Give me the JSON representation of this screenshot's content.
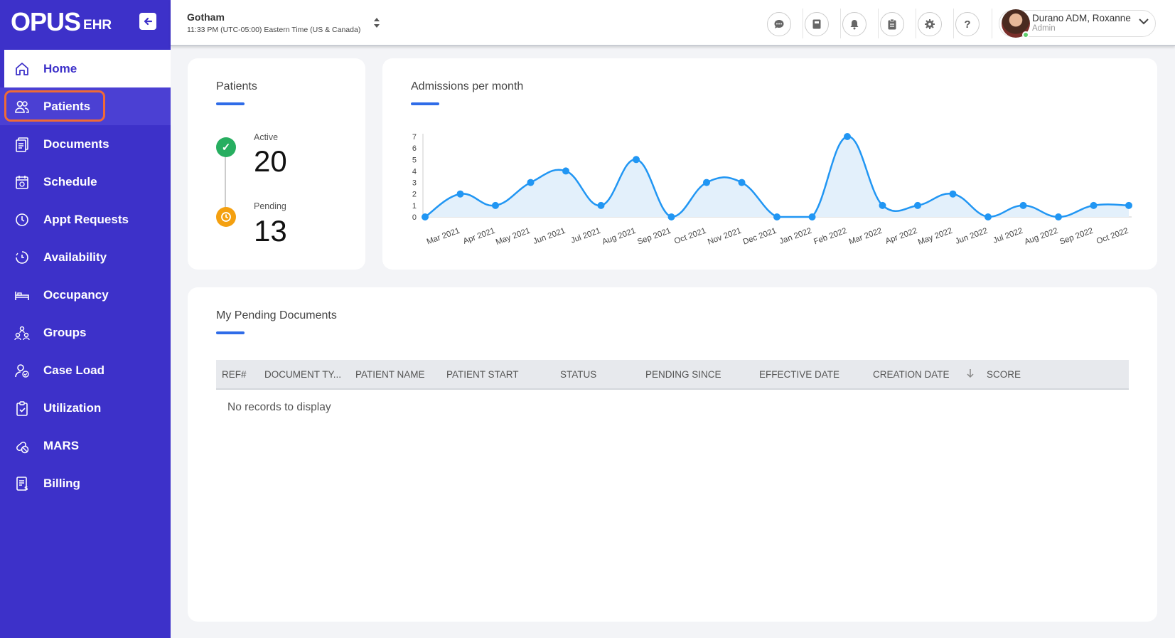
{
  "brand": {
    "logo": "OPUS",
    "sub": "EHR"
  },
  "sidebar": {
    "items": [
      {
        "label": "Home",
        "icon": "home-icon"
      },
      {
        "label": "Patients",
        "icon": "patients-icon"
      },
      {
        "label": "Documents",
        "icon": "documents-icon"
      },
      {
        "label": "Schedule",
        "icon": "calendar-icon"
      },
      {
        "label": "Appt Requests",
        "icon": "clock-icon"
      },
      {
        "label": "Availability",
        "icon": "availability-icon"
      },
      {
        "label": "Occupancy",
        "icon": "bed-icon"
      },
      {
        "label": "Groups",
        "icon": "groups-icon"
      },
      {
        "label": "Case Load",
        "icon": "case-load-icon"
      },
      {
        "label": "Utilization",
        "icon": "clipboard-check-icon"
      },
      {
        "label": "MARS",
        "icon": "pills-icon"
      },
      {
        "label": "Billing",
        "icon": "billing-icon"
      }
    ]
  },
  "header": {
    "location": "Gotham",
    "time": "11:33 PM (UTC-05:00) Eastern Time (US & Canada)",
    "user_name": "Durano ADM, Roxanne",
    "user_role": "Admin"
  },
  "patients_card": {
    "title": "Patients",
    "active_label": "Active",
    "active_value": "20",
    "pending_label": "Pending",
    "pending_value": "13"
  },
  "chart_card": {
    "title": "Admissions per month"
  },
  "chart_data": {
    "type": "area",
    "title": "Admissions per month",
    "xlabel": "",
    "ylabel": "",
    "categories": [
      "Mar 2021",
      "Apr 2021",
      "May 2021",
      "Jun 2021",
      "Jul 2021",
      "Aug 2021",
      "Sep 2021",
      "Oct 2021",
      "Nov 2021",
      "Dec 2021",
      "Jan 2022",
      "Feb 2022",
      "Mar 2022",
      "Apr 2022",
      "May 2022",
      "Jun 2022",
      "Jul 2022",
      "Aug 2022",
      "Sep 2022",
      "Oct 2022"
    ],
    "x_points": [
      "",
      "Mar 2021",
      "",
      "Apr 2021",
      "",
      "May 2021",
      "",
      "Jun 2021",
      "",
      "Jul 2021",
      "",
      "Aug 2021",
      "",
      "Sep 2021",
      "",
      "Oct 2021",
      "",
      "Nov 2021",
      "",
      "Dec 2021",
      "",
      "Jan 2022",
      "",
      "Feb 2022",
      "",
      "Mar 2022",
      "",
      "Apr 2022",
      "",
      "May 2022",
      "",
      "Jun 2022",
      "",
      "Jul 2022",
      "",
      "Aug 2022",
      "",
      "Sep 2022",
      "",
      "Oct 2022"
    ],
    "values": [
      0,
      2,
      1,
      3,
      4,
      1,
      5,
      0,
      3,
      3,
      0,
      0,
      7,
      1,
      1,
      2,
      0,
      1,
      0,
      1,
      1
    ],
    "yticks": [
      0,
      1,
      2,
      3,
      4,
      5,
      6,
      7
    ],
    "ylim": [
      0,
      7
    ],
    "color": "#2196f3",
    "fill": "#e3f0fb",
    "grid": false,
    "legend": "none"
  },
  "docs_card": {
    "title": "My Pending Documents",
    "columns": [
      "REF#",
      "DOCUMENT TY...",
      "PATIENT NAME",
      "PATIENT START",
      "STATUS",
      "PENDING SINCE",
      "EFFECTIVE DATE",
      "CREATION DATE",
      "SCORE"
    ],
    "empty_text": "No records to display"
  },
  "colors": {
    "sidebar": "#3d31c9",
    "accent": "#2f6ce8",
    "active": "#27ae60",
    "pending": "#f4a010",
    "highlight": "#f06a35"
  }
}
